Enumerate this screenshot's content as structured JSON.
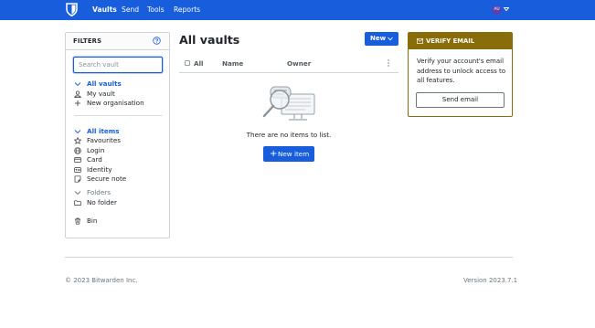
{
  "nav": {
    "links": [
      "Vaults",
      "Send",
      "Tools",
      "Reports"
    ],
    "active": "Vaults",
    "avatar_initials": "AU",
    "brand_color": "#175ddc"
  },
  "filters": {
    "title": "FILTERS",
    "search_placeholder": "Search vault",
    "vaults": {
      "label": "All vaults",
      "items": [
        "My vault",
        "New organisation"
      ]
    },
    "items": {
      "label": "All items",
      "types": [
        "Favourites",
        "Login",
        "Card",
        "Identity",
        "Secure note"
      ]
    },
    "folders": {
      "label": "Folders",
      "items": [
        "No folder"
      ]
    },
    "bin": "Bin",
    "icons": [
      "chevron-down-icon",
      "user-icon",
      "plus-icon",
      "star-icon",
      "globe-icon",
      "credit-card-icon",
      "id-card-icon",
      "sticky-note-icon",
      "trash-icon",
      "question-circle-icon"
    ]
  },
  "main": {
    "title": "All vaults",
    "new_button": "New",
    "columns": [
      "All",
      "Name",
      "Owner"
    ],
    "empty_text": "There are no items to list.",
    "new_item_button": "New item"
  },
  "verify": {
    "title": "VERIFY EMAIL",
    "text": "Verify your account's email address to unlock access to all features.",
    "button": "Send email",
    "accent_color": "#8a6d0b"
  },
  "footer": {
    "copyright": "© 2023 Bitwarden Inc.",
    "version": "Version 2023.7.1"
  }
}
